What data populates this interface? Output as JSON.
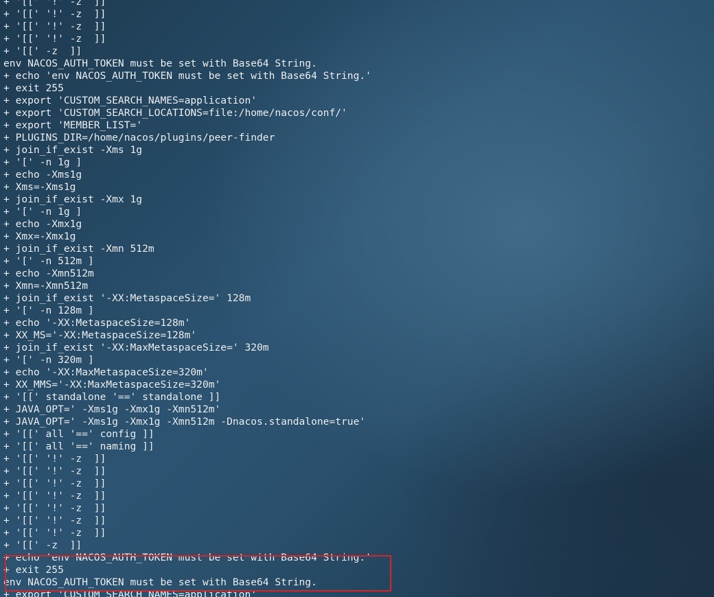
{
  "terminal": {
    "lines": [
      "+ '[[' '!' -z  ]]",
      "+ '[[' '!' -z  ]]",
      "+ '[[' '!' -z  ]]",
      "+ '[[' '!' -z  ]]",
      "+ '[[' -z  ]]",
      "env NACOS_AUTH_TOKEN must be set with Base64 String.",
      "+ echo 'env NACOS_AUTH_TOKEN must be set with Base64 String.'",
      "+ exit 255",
      "+ export 'CUSTOM_SEARCH_NAMES=application'",
      "+ export 'CUSTOM_SEARCH_LOCATIONS=file:/home/nacos/conf/'",
      "+ export 'MEMBER_LIST='",
      "+ PLUGINS_DIR=/home/nacos/plugins/peer-finder",
      "+ join_if_exist -Xms 1g",
      "+ '[' -n 1g ]",
      "+ echo -Xms1g",
      "+ Xms=-Xms1g",
      "+ join_if_exist -Xmx 1g",
      "+ '[' -n 1g ]",
      "+ echo -Xmx1g",
      "+ Xmx=-Xmx1g",
      "+ join_if_exist -Xmn 512m",
      "+ '[' -n 512m ]",
      "+ echo -Xmn512m",
      "+ Xmn=-Xmn512m",
      "+ join_if_exist '-XX:MetaspaceSize=' 128m",
      "+ '[' -n 128m ]",
      "+ echo '-XX:MetaspaceSize=128m'",
      "+ XX_MS='-XX:MetaspaceSize=128m'",
      "+ join_if_exist '-XX:MaxMetaspaceSize=' 320m",
      "+ '[' -n 320m ]",
      "+ echo '-XX:MaxMetaspaceSize=320m'",
      "+ XX_MMS='-XX:MaxMetaspaceSize=320m'",
      "+ '[[' standalone '==' standalone ]]",
      "+ JAVA_OPT=' -Xms1g -Xmx1g -Xmn512m'",
      "+ JAVA_OPT=' -Xms1g -Xmx1g -Xmn512m -Dnacos.standalone=true'",
      "+ '[[' all '==' config ]]",
      "+ '[[' all '==' naming ]]",
      "+ '[[' '!' -z  ]]",
      "+ '[[' '!' -z  ]]",
      "+ '[[' '!' -z  ]]",
      "+ '[[' '!' -z  ]]",
      "+ '[[' '!' -z  ]]",
      "+ '[[' '!' -z  ]]",
      "+ '[[' '!' -z  ]]",
      "+ '[[' -z  ]]",
      "+ echo 'env NACOS_AUTH_TOKEN must be set with Base64 String.'",
      "+ exit 255",
      "env NACOS_AUTH_TOKEN must be set with Base64 String.",
      "+ export 'CUSTOM_SEARCH_NAMES=application'"
    ]
  },
  "annotation": {
    "highlight_color": "#d92424"
  },
  "colors": {
    "text": "#eef3f6",
    "background": "#2c5472"
  }
}
